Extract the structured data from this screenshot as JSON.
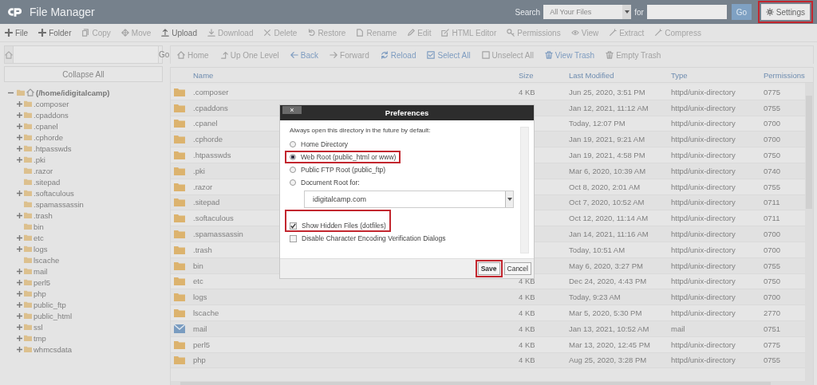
{
  "header": {
    "title": "File Manager",
    "search_label": "Search",
    "scope": "All Your Files",
    "for_label": "for",
    "go": "Go",
    "settings": {
      "label": "Settings",
      "highlighted": true
    }
  },
  "toolbar": [
    {
      "label": "File",
      "disabled": false
    },
    {
      "label": "Folder",
      "disabled": false
    },
    {
      "label": "Copy",
      "disabled": true
    },
    {
      "label": "Move",
      "disabled": true
    },
    {
      "label": "Upload",
      "disabled": false
    },
    {
      "label": "Download",
      "disabled": true
    },
    {
      "label": "Delete",
      "disabled": true
    },
    {
      "label": "Restore",
      "disabled": true
    },
    {
      "label": "Rename",
      "disabled": true
    },
    {
      "label": "Edit",
      "disabled": true
    },
    {
      "label": "HTML Editor",
      "disabled": true
    },
    {
      "label": "Permissions",
      "disabled": true
    },
    {
      "label": "View",
      "disabled": true
    },
    {
      "label": "Extract",
      "disabled": true
    },
    {
      "label": "Compress",
      "disabled": true
    }
  ],
  "path_bar": {
    "go": "Go"
  },
  "collapse_all": "Collapse All",
  "tree": {
    "label": "(/home/idigitalcamp)",
    "expanded": true,
    "children": [
      {
        "label": ".composer",
        "expandable": true
      },
      {
        "label": ".cpaddons",
        "expandable": true
      },
      {
        "label": ".cpanel",
        "expandable": true
      },
      {
        "label": ".cphorde",
        "expandable": true
      },
      {
        "label": ".htpasswds",
        "expandable": true
      },
      {
        "label": ".pki",
        "expandable": true
      },
      {
        "label": ".razor",
        "expandable": false
      },
      {
        "label": ".sitepad",
        "expandable": false
      },
      {
        "label": ".softaculous",
        "expandable": true
      },
      {
        "label": ".spamassassin",
        "expandable": false
      },
      {
        "label": ".trash",
        "expandable": true
      },
      {
        "label": "bin",
        "expandable": false
      },
      {
        "label": "etc",
        "expandable": true
      },
      {
        "label": "logs",
        "expandable": true
      },
      {
        "label": "lscache",
        "expandable": false
      },
      {
        "label": "mail",
        "expandable": true
      },
      {
        "label": "perl5",
        "expandable": true
      },
      {
        "label": "php",
        "expandable": true
      },
      {
        "label": "public_ftp",
        "expandable": true
      },
      {
        "label": "public_html",
        "expandable": true
      },
      {
        "label": "ssl",
        "expandable": true
      },
      {
        "label": "tmp",
        "expandable": true
      },
      {
        "label": "whmcsdata",
        "expandable": true
      }
    ]
  },
  "nav": [
    {
      "label": "Home",
      "disabled": true
    },
    {
      "label": "Up One Level",
      "disabled": true
    },
    {
      "label": "Back",
      "disabled": false
    },
    {
      "label": "Forward",
      "disabled": true
    },
    {
      "label": "Reload",
      "disabled": false
    },
    {
      "label": "Select All",
      "disabled": false
    },
    {
      "label": "Unselect All",
      "disabled": true
    },
    {
      "label": "View Trash",
      "disabled": false
    },
    {
      "label": "Empty Trash",
      "disabled": true
    }
  ],
  "table": {
    "columns": [
      "Name",
      "Size",
      "Last Modified",
      "Type",
      "Permissions"
    ],
    "rows": [
      {
        "kind": "folder",
        "name": ".composer",
        "size": "4 KB",
        "modified": "Jun 25, 2020, 3:51 PM",
        "type": "httpd/unix-directory",
        "permissions": "0775"
      },
      {
        "kind": "folder",
        "name": ".cpaddons",
        "modified": "Jan 12, 2021, 11:12 AM",
        "type": "httpd/unix-directory",
        "permissions": "0755"
      },
      {
        "kind": "folder",
        "name": ".cpanel",
        "modified": "Today, 12:07 PM",
        "type": "httpd/unix-directory",
        "permissions": "0700"
      },
      {
        "kind": "folder",
        "name": ".cphorde",
        "modified": "Jan 19, 2021, 9:21 AM",
        "type": "httpd/unix-directory",
        "permissions": "0700"
      },
      {
        "kind": "folder",
        "name": ".htpasswds",
        "modified": "Jan 19, 2021, 4:58 PM",
        "type": "httpd/unix-directory",
        "permissions": "0750"
      },
      {
        "kind": "folder",
        "name": ".pki",
        "modified": "Mar 6, 2020, 10:39 AM",
        "type": "httpd/unix-directory",
        "permissions": "0740"
      },
      {
        "kind": "folder",
        "name": ".razor",
        "modified": "Oct 8, 2020, 2:01 AM",
        "type": "httpd/unix-directory",
        "permissions": "0755"
      },
      {
        "kind": "folder",
        "name": ".sitepad",
        "modified": "Oct 7, 2020, 10:52 AM",
        "type": "httpd/unix-directory",
        "permissions": "0711"
      },
      {
        "kind": "folder",
        "name": ".softaculous",
        "modified": "Oct 12, 2020, 11:14 AM",
        "type": "httpd/unix-directory",
        "permissions": "0711"
      },
      {
        "kind": "folder",
        "name": ".spamassassin",
        "modified": "Jan 14, 2021, 11:16 AM",
        "type": "httpd/unix-directory",
        "permissions": "0700"
      },
      {
        "kind": "folder",
        "name": ".trash",
        "modified": "Today, 10:51 AM",
        "type": "httpd/unix-directory",
        "permissions": "0700"
      },
      {
        "kind": "folder",
        "name": "bin",
        "modified": "May 6, 2020, 3:27 PM",
        "type": "httpd/unix-directory",
        "permissions": "0755"
      },
      {
        "kind": "folder",
        "name": "etc",
        "size": "4 KB",
        "modified": "Dec 24, 2020, 4:43 PM",
        "type": "httpd/unix-directory",
        "permissions": "0750"
      },
      {
        "kind": "folder",
        "name": "logs",
        "size": "4 KB",
        "modified": "Today, 9:23 AM",
        "type": "httpd/unix-directory",
        "permissions": "0700"
      },
      {
        "kind": "folder",
        "name": "lscache",
        "size": "4 KB",
        "modified": "Mar 5, 2020, 5:30 PM",
        "type": "httpd/unix-directory",
        "permissions": "2770"
      },
      {
        "kind": "mail",
        "name": "mail",
        "size": "4 KB",
        "modified": "Jan 13, 2021, 10:52 AM",
        "type": "mail",
        "permissions": "0751"
      },
      {
        "kind": "folder",
        "name": "perl5",
        "size": "4 KB",
        "modified": "Mar 13, 2020, 12:45 PM",
        "type": "httpd/unix-directory",
        "permissions": "0775"
      },
      {
        "kind": "folder",
        "name": "php",
        "size": "4 KB",
        "modified": "Aug 25, 2020, 3:28 PM",
        "type": "httpd/unix-directory",
        "permissions": "0755"
      }
    ]
  },
  "dialog": {
    "title": "Preferences",
    "close": "×",
    "prompt": "Always open this directory in the future by default:",
    "options": [
      {
        "label": "Home Directory",
        "selected": false,
        "highlighted": false
      },
      {
        "label": "Web Root (public_html or www)",
        "selected": true,
        "highlighted": true
      },
      {
        "label": "Public FTP Root (public_ftp)",
        "selected": false,
        "highlighted": false
      },
      {
        "label": "Document Root for:",
        "selected": false,
        "highlighted": false
      }
    ],
    "domain": "idigitalcamp.com",
    "checkboxes": [
      {
        "label": "Show Hidden Files (dotfiles)",
        "checked": true,
        "highlighted": true
      },
      {
        "label": "Disable Character Encoding Verification Dialogs",
        "checked": false,
        "highlighted": false
      }
    ],
    "save": {
      "label": "Save",
      "highlighted": true
    },
    "cancel": "Cancel"
  }
}
